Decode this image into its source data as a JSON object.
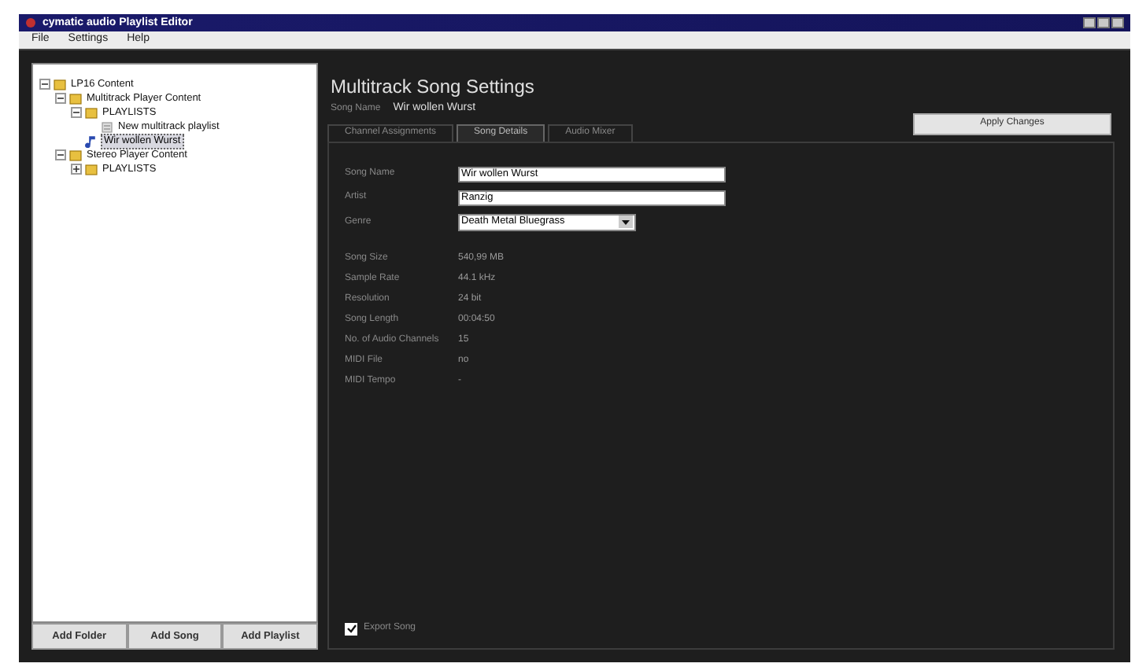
{
  "window": {
    "title": "cymatic audio Playlist Editor"
  },
  "menu": [
    "File",
    "Settings",
    "Help"
  ],
  "tree": [
    {
      "label": "LP16 Content",
      "kind": "folder",
      "expanded": true,
      "selected": false,
      "children": [
        {
          "label": "Multitrack Player Content",
          "kind": "folder",
          "expanded": true,
          "selected": false,
          "children": [
            {
              "label": "PLAYLISTS",
              "kind": "folder",
              "expanded": true,
              "selected": false,
              "children": [
                {
                  "label": "New multitrack playlist",
                  "kind": "playlist",
                  "selected": false
                }
              ]
            },
            {
              "label": "Wir wollen Wurst",
              "kind": "song",
              "selected": true
            }
          ]
        },
        {
          "label": "Stereo Player Content",
          "kind": "folder",
          "expanded": true,
          "selected": false,
          "children": [
            {
              "label": "PLAYLISTS",
              "kind": "folder",
              "expanded": false,
              "selected": false
            }
          ]
        }
      ]
    }
  ],
  "tree_buttons": [
    "Add Folder",
    "Add Song",
    "Add Playlist"
  ],
  "heading": "Multitrack Song Settings",
  "song_name_label": "Song Name",
  "song_name_value": "Wir wollen Wurst",
  "apply_button": "Apply Changes",
  "tabs": [
    {
      "label": "Channel Assignments",
      "selected": false
    },
    {
      "label": "Song Details",
      "selected": true
    },
    {
      "label": "Audio Mixer",
      "selected": false
    }
  ],
  "fields": [
    {
      "label": "Song Name",
      "kind": "text",
      "value": "Wir wollen Wurst"
    },
    {
      "label": "Artist",
      "kind": "text",
      "value": "Ranzig"
    },
    {
      "label": "Genre",
      "kind": "select",
      "value": "Death Metal Bluegrass"
    }
  ],
  "info": [
    {
      "label": "Song Size",
      "value": "540,99 MB"
    },
    {
      "label": "Sample Rate",
      "value": "44.1 kHz"
    },
    {
      "label": "Resolution",
      "value": "24 bit"
    },
    {
      "label": "Song Length",
      "value": "00:04:50"
    },
    {
      "label": "No. of Audio Channels",
      "value": "15"
    },
    {
      "label": "MIDI File",
      "value": "no"
    },
    {
      "label": "MIDI Tempo",
      "value": "-"
    }
  ],
  "export": {
    "label": "Export Song",
    "checked": true
  }
}
